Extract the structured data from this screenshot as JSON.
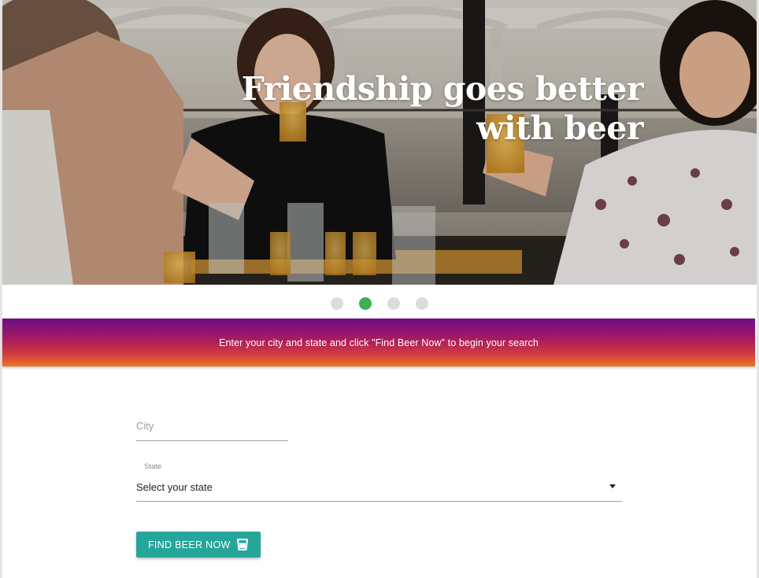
{
  "hero": {
    "title": "Friendship goes better with beer"
  },
  "carousel": {
    "slides": 4,
    "active_index": 1,
    "active_color": "#3fae55",
    "inactive_color": "#dcdcdc"
  },
  "banner": {
    "text": "Enter your city and state and click \"Find Beer Now\" to begin your search",
    "gradient_top": "#6d0f86",
    "gradient_bottom": "#f07624"
  },
  "form": {
    "city": {
      "placeholder": "City",
      "value": ""
    },
    "state": {
      "label": "State",
      "selected": "Select your state"
    },
    "submit": {
      "label": "FIND BEER NOW",
      "icon": "beer-glass-icon",
      "color": "#26a69a"
    }
  }
}
